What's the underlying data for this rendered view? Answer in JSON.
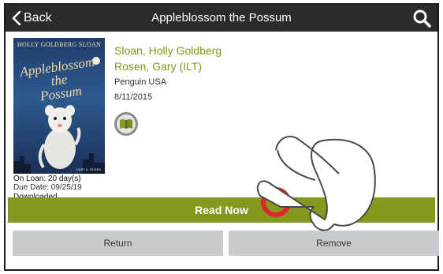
{
  "header": {
    "back_label": "Back",
    "title": "Appleblossom the Possum"
  },
  "cover": {
    "author": "HOLLY GOLDBERG SLOAN",
    "title_line1": "Appleblossom",
    "title_line2": "the",
    "title_line3": "Possum",
    "illustrator": "GARY A. ROSEN"
  },
  "book": {
    "author1": "Sloan, Holly Goldberg",
    "author2": "Rosen, Gary (ILT)",
    "publisher": "Penguin USA",
    "date": "8/11/2015"
  },
  "loan": {
    "on_loan": "On Loan: 20 day(s)",
    "due_date": "Due Date: 09/25/19",
    "status": "Downloaded"
  },
  "actions": {
    "read_now": "Read Now",
    "return": "Return",
    "remove": "Remove"
  },
  "colors": {
    "accent_green": "#86981e",
    "author_green": "#7a9a1e",
    "header_bg": "#2b2b2b",
    "gray_button": "#c9cccf",
    "tap_indicator": "#e0262b"
  },
  "icons": {
    "back": "chevron-left-icon",
    "search": "search-icon",
    "read": "open-book-icon",
    "overlay": "pointing-hand-icon"
  }
}
